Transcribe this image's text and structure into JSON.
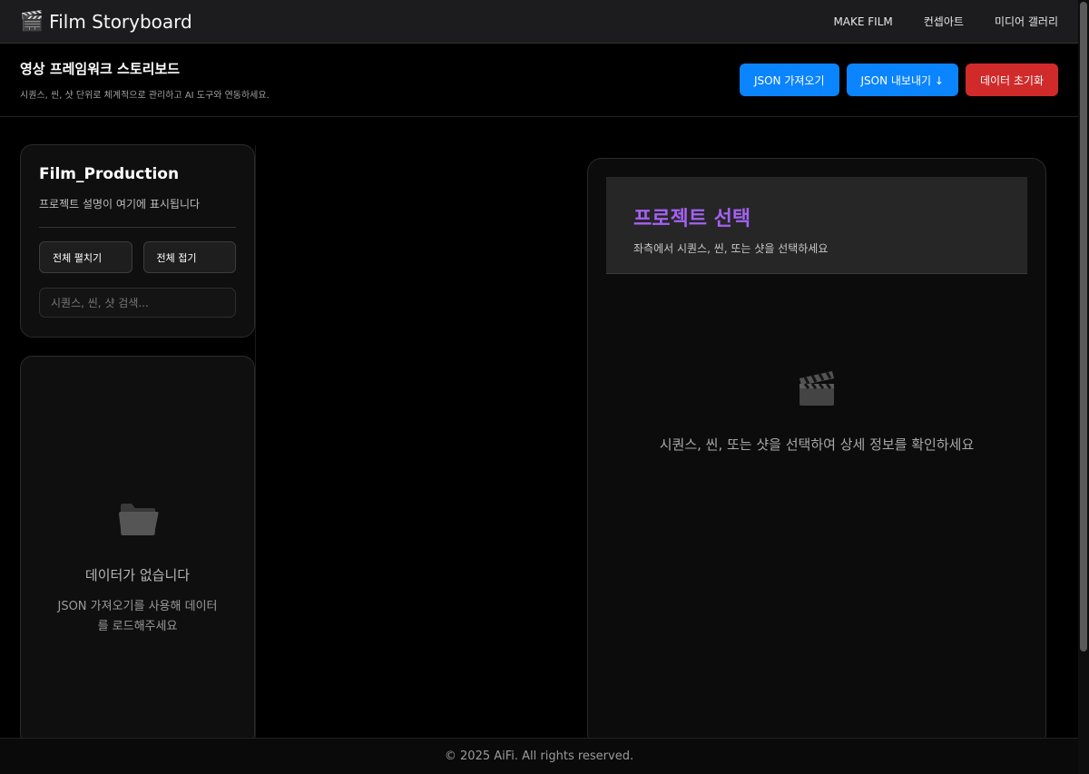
{
  "nav": {
    "brand_icon": "clapper-board-icon",
    "title": "Film Storyboard",
    "links": [
      "MAKE FILM",
      "컨셉아트",
      "미디어 갤러리"
    ]
  },
  "header": {
    "title": "영상 프레임워크 스토리보드",
    "subtitle": "시퀀스, 씬, 샷 단위로 체계적으로 관리하고 AI 도구와 연동하세요.",
    "buttons": {
      "import": "JSON 가져오기",
      "export": "JSON 내보내기 ↓",
      "reset": "데이터 초기화"
    }
  },
  "sidebar": {
    "project_name": "Film_Production",
    "project_desc": "프로젝트 설명이 여기에 표시됩니다",
    "expand_all": "전체 펼치기",
    "collapse_all": "전체 접기",
    "search_placeholder": "시퀀스, 씬, 샷 검색...",
    "empty": {
      "icon": "folder-icon",
      "title": "데이터가 없습니다",
      "desc": "JSON 가져오기를 사용해 데이터를 로드해주세요"
    }
  },
  "detail": {
    "title": "프로젝트 선택",
    "subtitle": "좌측에서 시퀀스, 씬, 또는 샷을 선택하세요",
    "icon": "clapper-board-icon",
    "message": "시퀀스, 씬, 또는 샷을 선택하여 상세 정보를 확인하세요"
  },
  "footer": {
    "text": "© 2025 AiFi. All rights reserved."
  },
  "colors": {
    "accent_blue": "#0a84ff",
    "danger_red": "#d12a2a",
    "title_purple": "#a461f2"
  }
}
